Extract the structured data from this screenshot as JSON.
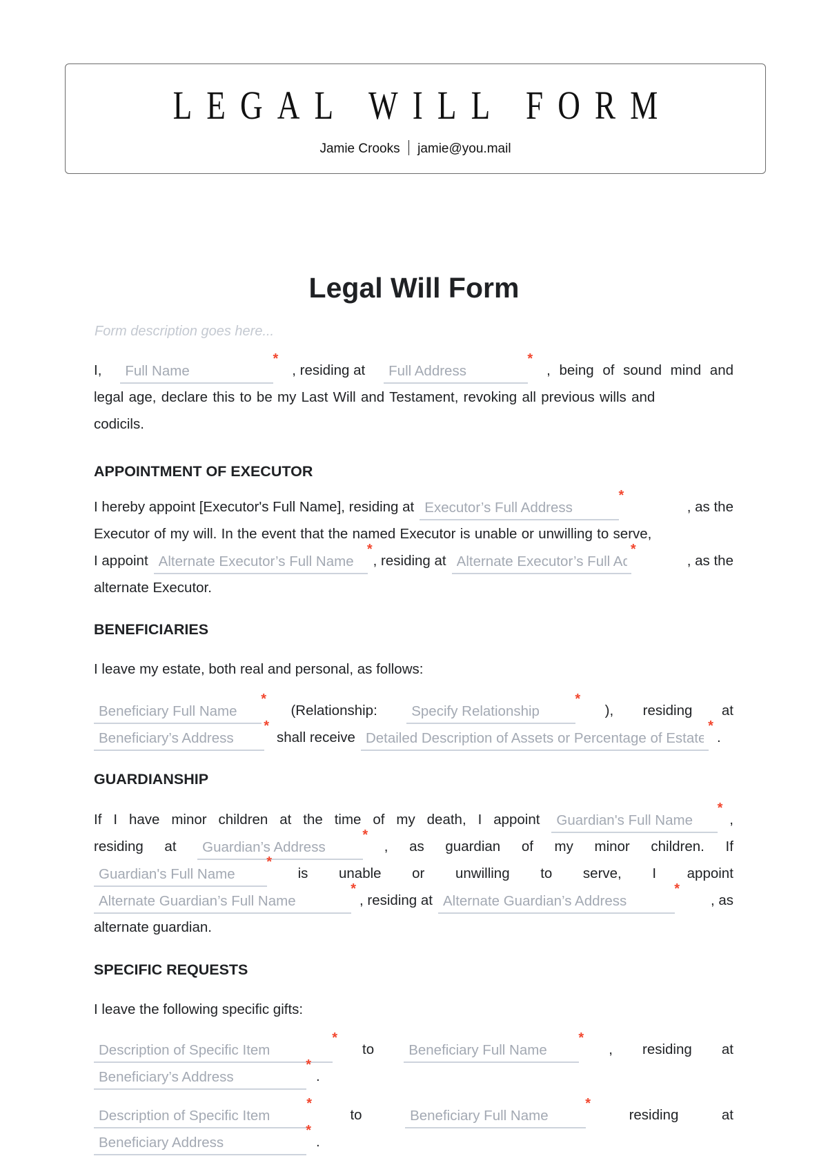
{
  "header": {
    "title": "LEGAL WILL FORM",
    "name": "Jamie Crooks",
    "email": "jamie@you.mail"
  },
  "form": {
    "title": "Legal Will Form",
    "description_placeholder": "Form description goes here...",
    "required_marker": "*",
    "accent_required_color": "#f2462e",
    "intro": {
      "t1": "I,",
      "full_name_placeholder": "Full Name",
      "t2": ", residing at",
      "full_address_placeholder": "Full Address",
      "t3": ", being of sound mind and",
      "line2": "legal age, declare this to be my Last Will and Testament, revoking all previous wills and",
      "line3": "codicils."
    },
    "sections": {
      "executor": {
        "heading": "APPOINTMENT OF EXECUTOR",
        "t1": "I hereby appoint [Executor's Full Name], residing at",
        "executor_address_placeholder": "Executor’s Full Address",
        "t2": ", as the",
        "line2": "Executor of my will. In the event that the named Executor is unable or unwilling to serve,",
        "t3": "I appoint",
        "alt_executor_name_placeholder": "Alternate Executor’s Full Name",
        "t4": ", residing at",
        "alt_executor_address_placeholder": "Alternate Executor’s Full Address",
        "t5": ", as the",
        "line4": "alternate Executor."
      },
      "beneficiaries": {
        "heading": "BENEFICIARIES",
        "intro": "I leave my estate, both real and personal, as follows:",
        "beneficiary_name_placeholder": "Beneficiary Full Name",
        "t1": "(Relationship:",
        "relationship_placeholder": "Specify Relationship",
        "t2": "),",
        "t3": "residing",
        "t4": "at",
        "beneficiary_address_placeholder": "Beneficiary’s Address",
        "t5": "shall receive",
        "assets_placeholder": "Detailed Description of Assets or Percentage of Estate",
        "t6": "."
      },
      "guardianship": {
        "heading": "GUARDIANSHIP",
        "line1_words": [
          "If",
          "I",
          "have",
          "minor",
          "children",
          "at",
          "the",
          "time",
          "of",
          "my",
          "death,",
          "I",
          "appoint"
        ],
        "guardian_name_placeholder": "Guardian's Full Name",
        "t_comma": ",",
        "line2_pre": [
          "residing",
          "at"
        ],
        "guardian_address_placeholder": "Guardian’s Address",
        "line2_post": [
          ",",
          "as",
          "guardian",
          "of",
          "my",
          "minor",
          "children.",
          "If"
        ],
        "guardian_name2_placeholder": "Guardian's Full Name",
        "line3_post": [
          "is",
          "unable",
          "or",
          "unwilling",
          "to",
          "serve,",
          "I",
          "appoint"
        ],
        "alt_guardian_name_placeholder": "Alternate Guardian’s Full Name",
        "t_residing": ", residing at",
        "alt_guardian_address_placeholder": "Alternate Guardian’s Address",
        "t_as": ", as",
        "line5": "alternate guardian."
      },
      "specific_requests": {
        "heading": "SPECIFIC REQUESTS",
        "intro": "I leave the following specific gifts:",
        "gifts": [
          {
            "item_placeholder": "Description of Specific Item",
            "to": "to",
            "beneficiary_placeholder": "Beneficiary Full Name",
            "comma": ",",
            "residing": "residing",
            "at": "at",
            "address_placeholder": "Beneficiary’s Address",
            "end": "."
          },
          {
            "item_placeholder": "Description of Specific Item",
            "to": "to",
            "beneficiary_placeholder": "Beneficiary Full Name",
            "comma": "",
            "residing": "residing",
            "at": "at",
            "address_placeholder": "Beneficiary Address",
            "end": "."
          }
        ]
      }
    }
  }
}
